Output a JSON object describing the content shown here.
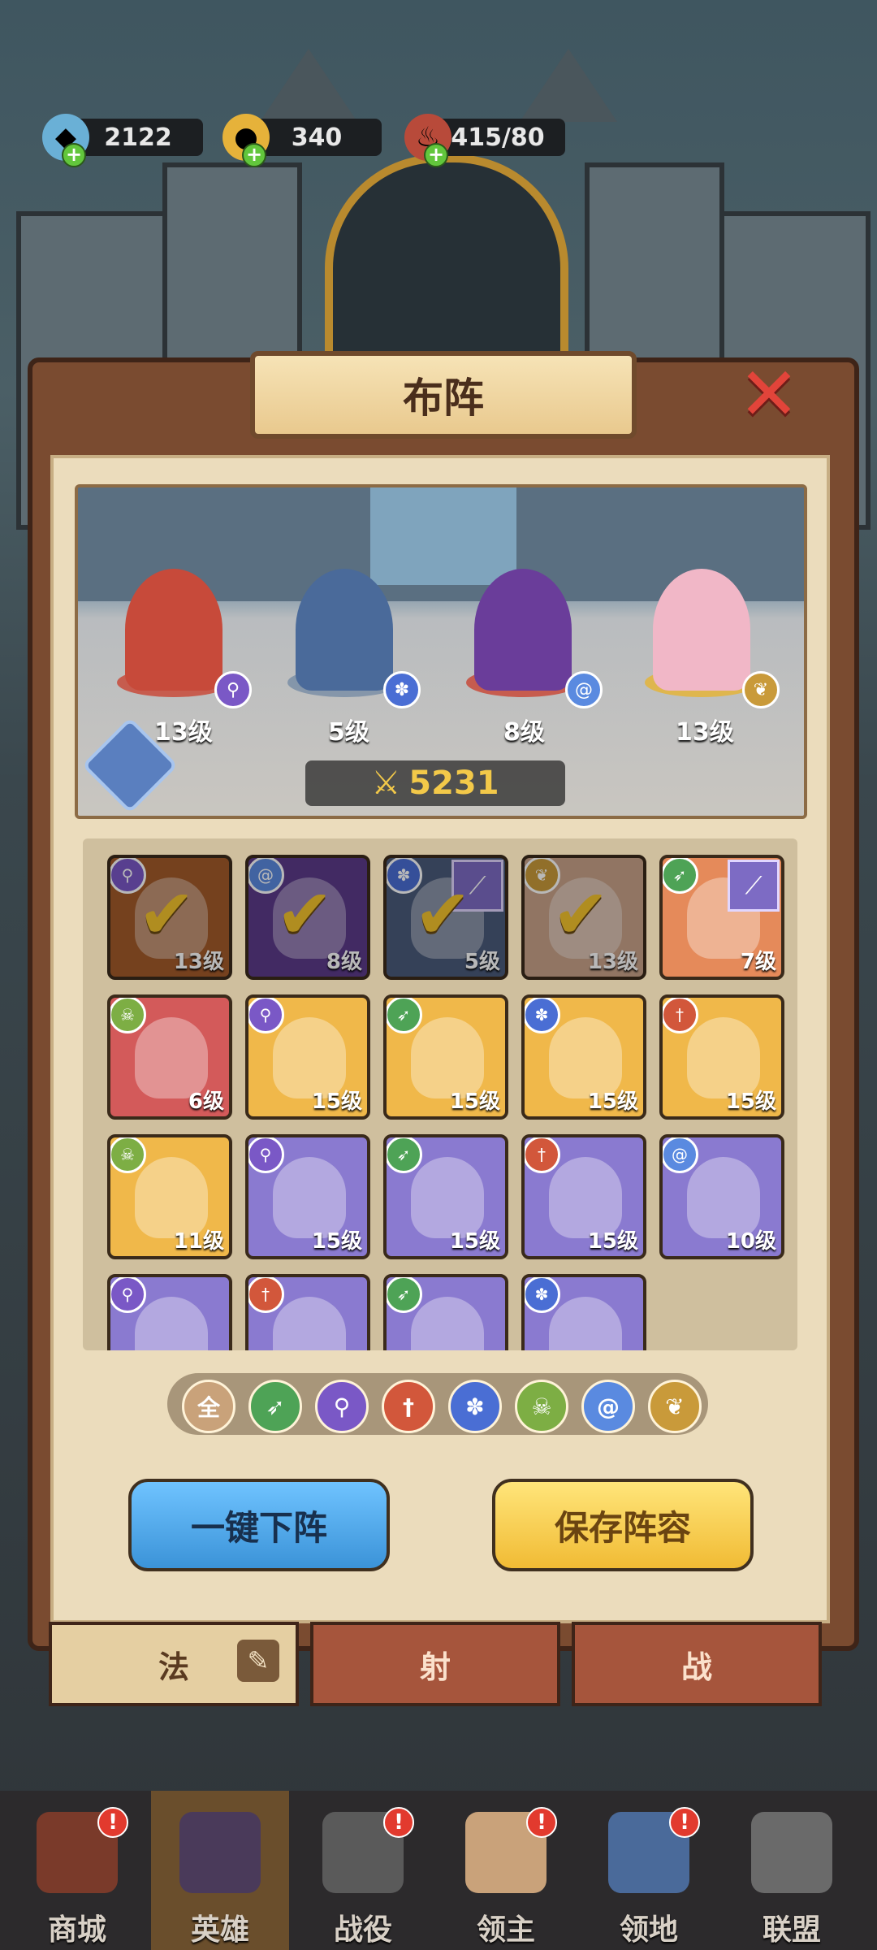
{
  "resources": {
    "gems": "2122",
    "gold": "340",
    "stamina": "415/80"
  },
  "panel": {
    "title": "布阵",
    "close_icon": "close-x-icon"
  },
  "formation": {
    "power": "5231",
    "heroes": [
      {
        "level": "13级",
        "class_icon": "staff-icon",
        "color": "#d0463a"
      },
      {
        "level": "5级",
        "class_icon": "paw-icon",
        "color": "#4a6a9a"
      },
      {
        "level": "8级",
        "class_icon": "swirl-icon",
        "color": "#6a3d9a"
      },
      {
        "level": "13级",
        "class_icon": "crest-icon",
        "color": "#f1b7c7"
      }
    ]
  },
  "roster": [
    {
      "level": "13级",
      "class": "staff",
      "selected": true,
      "color": "#a35a2a"
    },
    {
      "level": "8级",
      "class": "swirl",
      "selected": true,
      "color": "#5b3a8a"
    },
    {
      "level": "5级",
      "class": "paw",
      "selected": true,
      "color": "#4a5a7a",
      "weapon": true
    },
    {
      "level": "13级",
      "class": "crest",
      "selected": true,
      "color": "#c9a38a"
    },
    {
      "level": "7级",
      "class": "bow",
      "selected": false,
      "color": "#e58a5a",
      "weapon": true
    },
    {
      "level": "6级",
      "class": "skull",
      "selected": false,
      "color": "#d35a5a"
    },
    {
      "level": "15级",
      "class": "staff",
      "selected": false,
      "color": "#f0b84a"
    },
    {
      "level": "15级",
      "class": "bow",
      "selected": false,
      "color": "#f0b84a"
    },
    {
      "level": "15级",
      "class": "paw",
      "selected": false,
      "color": "#f0b84a"
    },
    {
      "level": "15级",
      "class": "sword",
      "selected": false,
      "color": "#f0b84a"
    },
    {
      "level": "11级",
      "class": "skull",
      "selected": false,
      "color": "#f0b84a"
    },
    {
      "level": "15级",
      "class": "staff",
      "selected": false,
      "color": "#8a7ad0"
    },
    {
      "level": "15级",
      "class": "bow",
      "selected": false,
      "color": "#8a7ad0"
    },
    {
      "level": "15级",
      "class": "sword",
      "selected": false,
      "color": "#8a7ad0"
    },
    {
      "level": "10级",
      "class": "swirl",
      "selected": false,
      "color": "#8a7ad0"
    },
    {
      "level": "",
      "class": "staff",
      "selected": false,
      "color": "#8a7ad0"
    },
    {
      "level": "",
      "class": "sword",
      "selected": false,
      "color": "#8a7ad0"
    },
    {
      "level": "",
      "class": "bow",
      "selected": false,
      "color": "#8a7ad0"
    },
    {
      "level": "",
      "class": "paw",
      "selected": false,
      "color": "#8a7ad0"
    }
  ],
  "filters": [
    {
      "label": "全",
      "icon": "all-icon",
      "color": "#c9a27a"
    },
    {
      "label": "",
      "icon": "bow-icon",
      "color": "#4ea356"
    },
    {
      "label": "",
      "icon": "staff-icon",
      "color": "#7a58c6"
    },
    {
      "label": "",
      "icon": "sword-icon",
      "color": "#d2573b"
    },
    {
      "label": "",
      "icon": "paw-icon",
      "color": "#4a6ed4"
    },
    {
      "label": "",
      "icon": "skull-icon",
      "color": "#7dae44"
    },
    {
      "label": "",
      "icon": "swirl-icon",
      "color": "#5a8ae0"
    },
    {
      "label": "",
      "icon": "crest-icon",
      "color": "#c99a3a"
    }
  ],
  "actions": {
    "unequip_all": "一键下阵",
    "save_lineup": "保存阵容"
  },
  "class_tabs": [
    "法",
    "射",
    "战"
  ],
  "nav": [
    {
      "label": "商城",
      "alert": "!"
    },
    {
      "label": "英雄",
      "alert": ""
    },
    {
      "label": "战役",
      "alert": "!"
    },
    {
      "label": "领主",
      "alert": "!"
    },
    {
      "label": "领地",
      "alert": "!"
    },
    {
      "label": "联盟",
      "alert": ""
    }
  ]
}
